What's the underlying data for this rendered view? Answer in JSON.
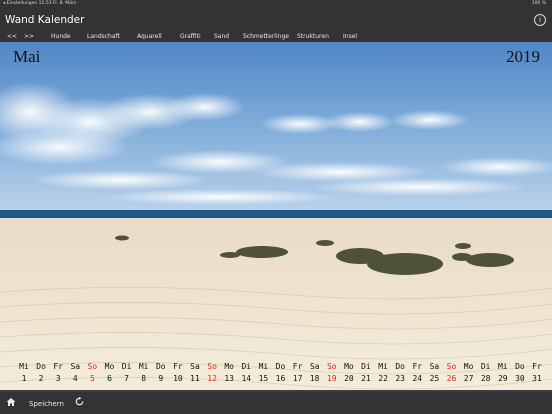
{
  "status": {
    "left": "◂ Einstellungen  11:53  Fr. 8. März",
    "right": "100 %"
  },
  "app": {
    "title": "Wand Kalender"
  },
  "info_sub": "",
  "nav": {
    "prev": "<<",
    "next": ">>",
    "tabs": [
      "Hunde",
      "Landschaft",
      "Aquarell",
      "Graffiti",
      "Sand",
      "Schmetterlinge",
      "Strukturen",
      "Insel"
    ]
  },
  "calendar": {
    "month": "Mai",
    "year": "2019",
    "weekdays": [
      "Mi",
      "Do",
      "Fr",
      "Sa",
      "So",
      "Mo",
      "Di",
      "Mi",
      "Do",
      "Fr",
      "Sa",
      "So",
      "Mo",
      "Di",
      "Mi",
      "Do",
      "Fr",
      "Sa",
      "So",
      "Mo",
      "Di",
      "Mi",
      "Do",
      "Fr",
      "Sa",
      "So",
      "Mo",
      "Di",
      "Mi",
      "Do",
      "Fr"
    ],
    "days": [
      "1",
      "2",
      "3",
      "4",
      "5",
      "6",
      "7",
      "8",
      "9",
      "10",
      "11",
      "12",
      "13",
      "14",
      "15",
      "16",
      "17",
      "18",
      "19",
      "20",
      "21",
      "22",
      "23",
      "24",
      "25",
      "26",
      "27",
      "28",
      "29",
      "30",
      "31"
    ],
    "sunday_color": "#e0271b"
  },
  "toolbar": {
    "save_label": "Speichern"
  },
  "icons": {
    "home": "home-icon",
    "refresh": "refresh-icon",
    "info": "info-icon"
  }
}
